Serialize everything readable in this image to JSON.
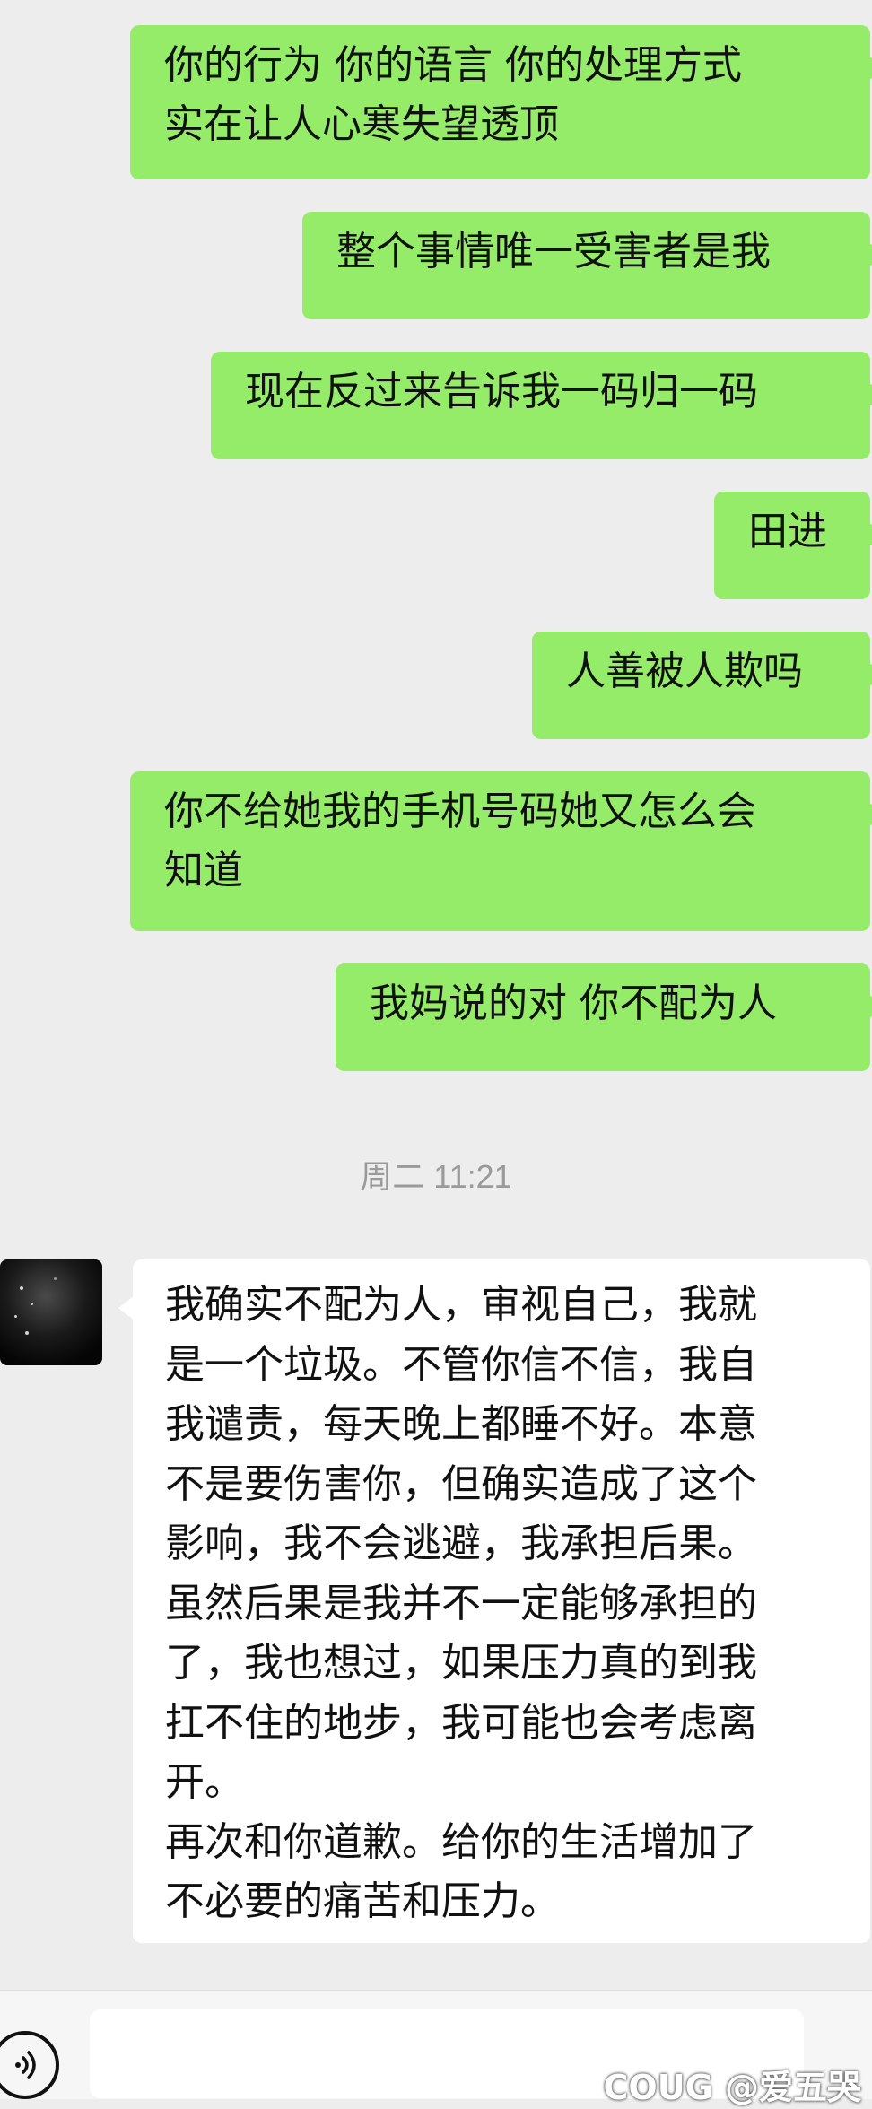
{
  "messages": [
    {
      "from": "me",
      "text": "你的行为 你的语言 你的处理方式\n实在让人心寒失望透顶"
    },
    {
      "from": "me",
      "text": "整个事情唯一受害者是我"
    },
    {
      "from": "me",
      "text": "现在反过来告诉我一码归一码"
    },
    {
      "from": "me",
      "text": "田进"
    },
    {
      "from": "me",
      "text": "人善被人欺吗"
    },
    {
      "from": "me",
      "text": "你不给她我的手机号码她又怎么会\n知道"
    },
    {
      "from": "me",
      "text": "我妈说的对 你不配为人"
    }
  ],
  "timestamp": "周二 11:21",
  "reply": {
    "from": "other",
    "text": "我确实不配为人，审视自己，我就\n是一个垃圾。不管你信不信，我自\n我谴责，每天晚上都睡不好。本意\n不是要伤害你，但确实造成了这个\n影响，我不会逃避，我承担后果。\n虽然后果是我并不一定能够承担的\n了，我也想过，如果压力真的到我\n扛不住的地步，我可能也会考虑离\n开。\n再次和你道歉。给你的生活增加了\n不必要的痛苦和压力。"
  },
  "input_bar": {
    "voice_icon": "voice-icon"
  },
  "watermark": "COUG @爱五哭",
  "colors": {
    "background": "#ededed",
    "outgoing_bubble": "#95ec69",
    "incoming_bubble": "#ffffff",
    "timestamp_text": "#9a9a9a"
  }
}
